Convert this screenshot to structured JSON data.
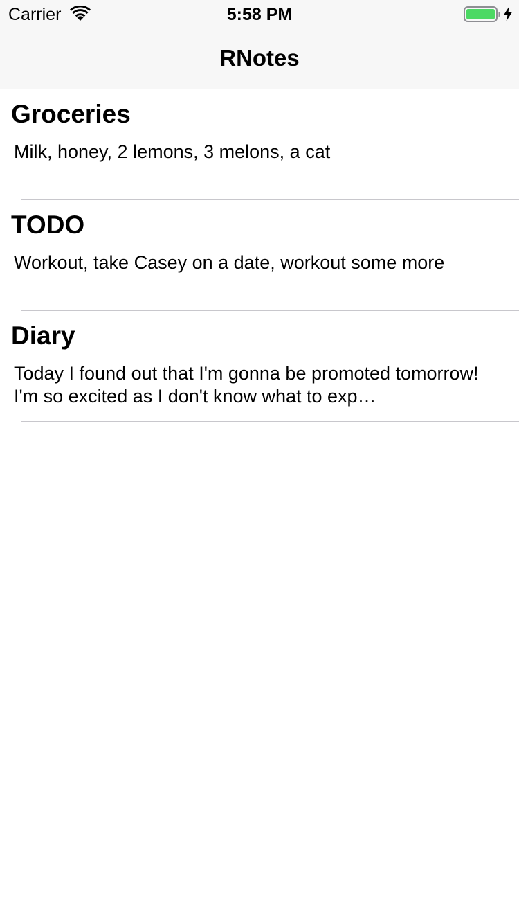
{
  "status_bar": {
    "carrier": "Carrier",
    "time": "5:58 PM",
    "battery_color": "#4cd964",
    "icons": [
      "wifi-icon",
      "battery-icon",
      "charging-bolt-icon"
    ]
  },
  "nav": {
    "title": "RNotes"
  },
  "notes": [
    {
      "title": "Groceries",
      "body": "Milk, honey, 2 lemons, 3 melons, a cat"
    },
    {
      "title": "TODO",
      "body": "Workout, take Casey on a date, workout some more"
    },
    {
      "title": "Diary",
      "body": "Today I found out that I'm gonna be promoted tomorrow! I'm so excited as I don't know what to exp…"
    }
  ]
}
